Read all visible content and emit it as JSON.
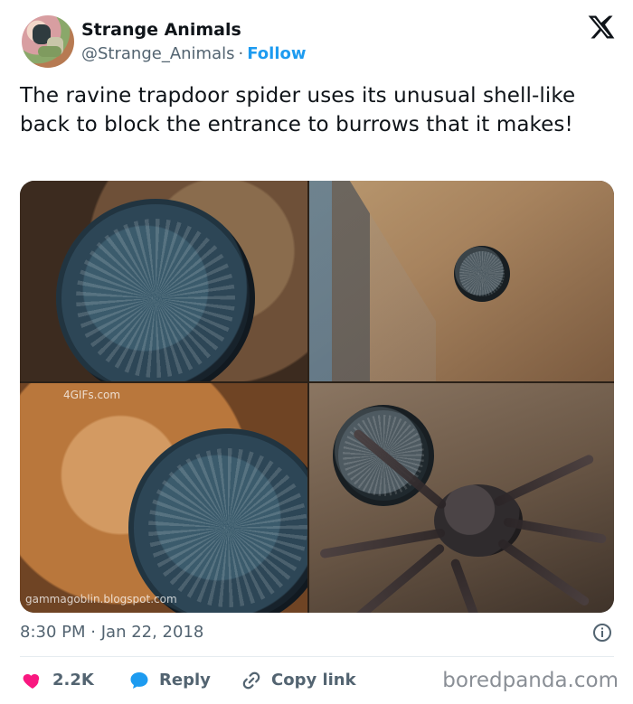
{
  "account": {
    "name": "Strange Animals",
    "handle": "@Strange_Animals",
    "separator": "·",
    "follow_label": "Follow"
  },
  "tweet": {
    "text": "The ravine trapdoor spider uses its unusual shell-like back to block the entrance to burrows that it makes!",
    "time": "8:30 PM",
    "date_separator": "·",
    "date": "Jan 22, 2018"
  },
  "media": {
    "watermarks": {
      "top_left_bottom": "4GIFs.com",
      "bottom_left": "gammagoblin.blogspot.com"
    }
  },
  "actions": {
    "likes": "2.2K",
    "reply_label": "Reply",
    "copy_label": "Copy link"
  },
  "footer": {
    "credit": "boredpanda.com"
  },
  "icons": {
    "logo": "x-logo-icon",
    "info": "info-icon",
    "like": "heart-icon",
    "reply": "speech-bubble-icon",
    "copy": "link-icon"
  },
  "colors": {
    "link": "#1d9bf0",
    "text": "#0f1419",
    "muted": "#536471",
    "heart": "#f91880"
  }
}
